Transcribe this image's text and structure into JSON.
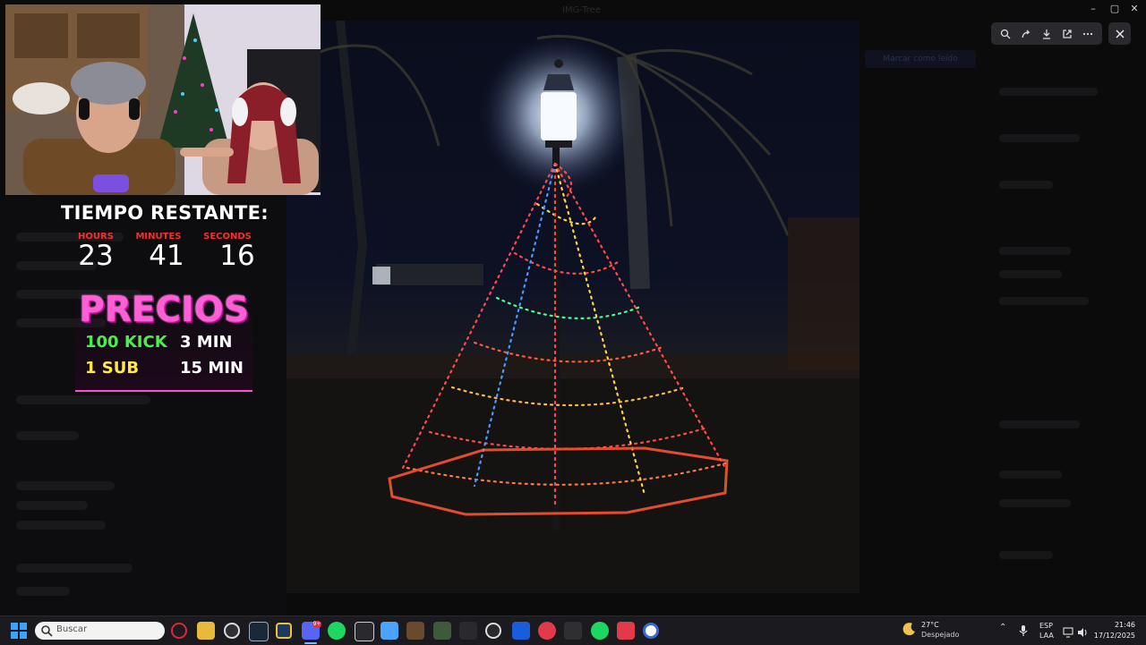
{
  "background_app": {
    "title": "IMG-Tree",
    "pill_label": "Marcar como leído"
  },
  "window_controls": {
    "minimize": "–",
    "maximize": "▢",
    "close": "✕"
  },
  "viewer": {
    "tools": [
      "zoom-icon",
      "share-icon",
      "download-icon",
      "open-external-icon",
      "more-icon"
    ],
    "close_icon": "close-icon"
  },
  "stream_overlay": {
    "timer": {
      "title": "TIEMPO RESTANTE:",
      "labels": {
        "hours": "HOURS",
        "minutes": "MINUTES",
        "seconds": "SECONDS"
      },
      "values": {
        "hours": "23",
        "minutes": "41",
        "seconds": "16"
      }
    },
    "prices": {
      "title": "PRECIOS",
      "rows": [
        {
          "left": "100 KICK",
          "right": "3 MIN",
          "left_color": "#49f04a"
        },
        {
          "left": "1 SUB",
          "right": "15 MIN",
          "left_color": "#ffe84a"
        }
      ]
    }
  },
  "taskbar": {
    "search_placeholder": "Buscar",
    "discord_badge": "9+",
    "apps": [
      "opera",
      "file-explorer",
      "chrome",
      "steam",
      "shield",
      "discord",
      "spotify",
      "bm",
      "notepad",
      "game-a",
      "game-b",
      "car",
      "ghub",
      "bitwarden",
      "app-red",
      "obs",
      "spotify-2",
      "news",
      "app-blue"
    ],
    "weather": {
      "temp": "27°C",
      "desc": "Despejado"
    },
    "language": {
      "lang": "ESP",
      "layout": "LAA"
    },
    "clock": {
      "time": "21:46",
      "date": "17/12/2025"
    }
  },
  "colors": {
    "timer_label": "#ff2b2b",
    "precios_pink": "#ff5fd6",
    "accent_blue": "#3aa2ff"
  }
}
